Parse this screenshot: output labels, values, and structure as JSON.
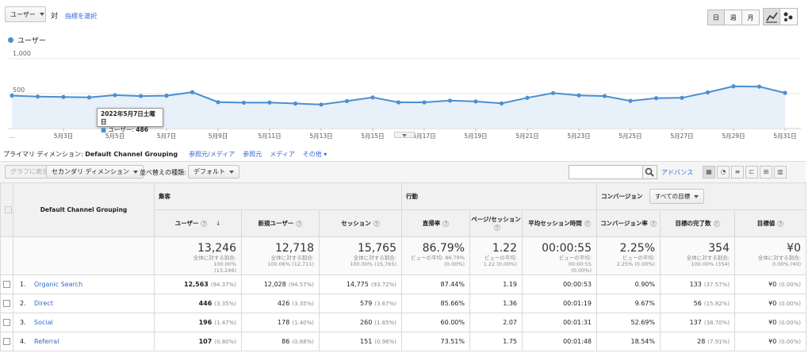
{
  "controls": {
    "metric_select": "ユーザー",
    "versus_label": "対",
    "select_metric_link": "指標を選択",
    "period_day": "日",
    "period_week": "週",
    "period_month": "月"
  },
  "chart_data": {
    "type": "line",
    "legend": "ユーザー",
    "yticks": [
      "1,000",
      "500"
    ],
    "ylim": [
      0,
      1000
    ],
    "x_first_label": "...",
    "xticks": [
      "5月3日",
      "5月5日",
      "5月7日",
      "5月9日",
      "5月11日",
      "5月13日",
      "5月15日",
      "5月17日",
      "5月19日",
      "5月21日",
      "5月23日",
      "5月25日",
      "5月27日",
      "5月29日",
      "5月31日"
    ],
    "values": [
      472,
      458,
      452,
      446,
      478,
      465,
      470,
      520,
      378,
      370,
      372,
      358,
      343,
      393,
      445,
      375,
      375,
      400,
      388,
      360,
      440,
      508,
      475,
      465,
      396,
      435,
      440,
      517,
      605,
      600,
      510
    ],
    "series_color": "#4b8fcf"
  },
  "tooltip": {
    "date": "2022年5月7日土曜日",
    "metric": "ユーザー:",
    "value": "486"
  },
  "dimension_bar": {
    "label": "プライマリ ディメンション:",
    "active": "Default Channel Grouping",
    "links": [
      "参照元/メディア",
      "参照元",
      "メディア",
      "その他"
    ]
  },
  "toolbar": {
    "plot_rows": "グラフに表示",
    "secondary_dim": "セカンダリ ディメンション",
    "sort_label": "並べ替えの種類:",
    "sort_value": "デフォルト",
    "advanced": "アドバンス"
  },
  "table": {
    "dim_header": "Default Channel Grouping",
    "groups": {
      "acquisition": "集客",
      "behavior": "行動",
      "conversion": "コンバージョン",
      "goal_select": "すべての目標"
    },
    "columns": [
      "ユーザー",
      "新規ユーザー",
      "セッション",
      "直帰率",
      "ページ/セッション",
      "平均セッション時間",
      "コンバージョン率",
      "目標の完了数",
      "目標値"
    ],
    "totals": [
      {
        "value": "13,246",
        "sub1": "全体に対する割合:",
        "sub2": "100.00%",
        "sub3": "(13,246)"
      },
      {
        "value": "12,718",
        "sub1": "全体に対する割合:",
        "sub2": "100.06% (12,711)",
        "sub3": ""
      },
      {
        "value": "15,765",
        "sub1": "全体に対する割合:",
        "sub2": "100.00% (15,765)",
        "sub3": ""
      },
      {
        "value": "86.79%",
        "sub1": "ビューの平均: 86.79%",
        "sub2": "(0.00%)",
        "sub3": ""
      },
      {
        "value": "1.22",
        "sub1": "ビューの平均:",
        "sub2": "1.22 (0.00%)",
        "sub3": ""
      },
      {
        "value": "00:00:55",
        "sub1": "ビューの平均:",
        "sub2": "00:00:55",
        "sub3": "(0.00%)"
      },
      {
        "value": "2.25%",
        "sub1": "ビューの平均:",
        "sub2": "2.25% (0.00%)",
        "sub3": ""
      },
      {
        "value": "354",
        "sub1": "全体に対する割合:",
        "sub2": "100.00% (354)",
        "sub3": ""
      },
      {
        "value": "¥0",
        "sub1": "全体に対する割合:",
        "sub2": "0.00% (¥0)",
        "sub3": ""
      }
    ],
    "rows": [
      {
        "idx": "1.",
        "name": "Organic Search",
        "users": "12,563",
        "users_pct": "(94.37%)",
        "new": "12,028",
        "new_pct": "(94.57%)",
        "sessions": "14,775",
        "sessions_pct": "(93.72%)",
        "bounce": "87.44%",
        "pps": "1.19",
        "avg": "00:00:53",
        "cr": "0.90%",
        "goals": "133",
        "goals_pct": "(37.57%)",
        "value": "¥0",
        "value_pct": "(0.00%)"
      },
      {
        "idx": "2.",
        "name": "Direct",
        "users": "446",
        "users_pct": "(3.35%)",
        "new": "426",
        "new_pct": "(3.35%)",
        "sessions": "579",
        "sessions_pct": "(3.67%)",
        "bounce": "85.66%",
        "pps": "1.36",
        "avg": "00:01:19",
        "cr": "9.67%",
        "goals": "56",
        "goals_pct": "(15.82%)",
        "value": "¥0",
        "value_pct": "(0.00%)"
      },
      {
        "idx": "3.",
        "name": "Social",
        "users": "196",
        "users_pct": "(1.47%)",
        "new": "178",
        "new_pct": "(1.40%)",
        "sessions": "260",
        "sessions_pct": "(1.65%)",
        "bounce": "60.00%",
        "pps": "2.07",
        "avg": "00:01:31",
        "cr": "52.69%",
        "goals": "137",
        "goals_pct": "(38.70%)",
        "value": "¥0",
        "value_pct": "(0.00%)"
      },
      {
        "idx": "4.",
        "name": "Referral",
        "users": "107",
        "users_pct": "(0.80%)",
        "new": "86",
        "new_pct": "(0.68%)",
        "sessions": "151",
        "sessions_pct": "(0.96%)",
        "bounce": "73.51%",
        "pps": "1.75",
        "avg": "00:01:48",
        "cr": "18.54%",
        "goals": "28",
        "goals_pct": "(7.91%)",
        "value": "¥0",
        "value_pct": "(0.00%)"
      }
    ]
  }
}
